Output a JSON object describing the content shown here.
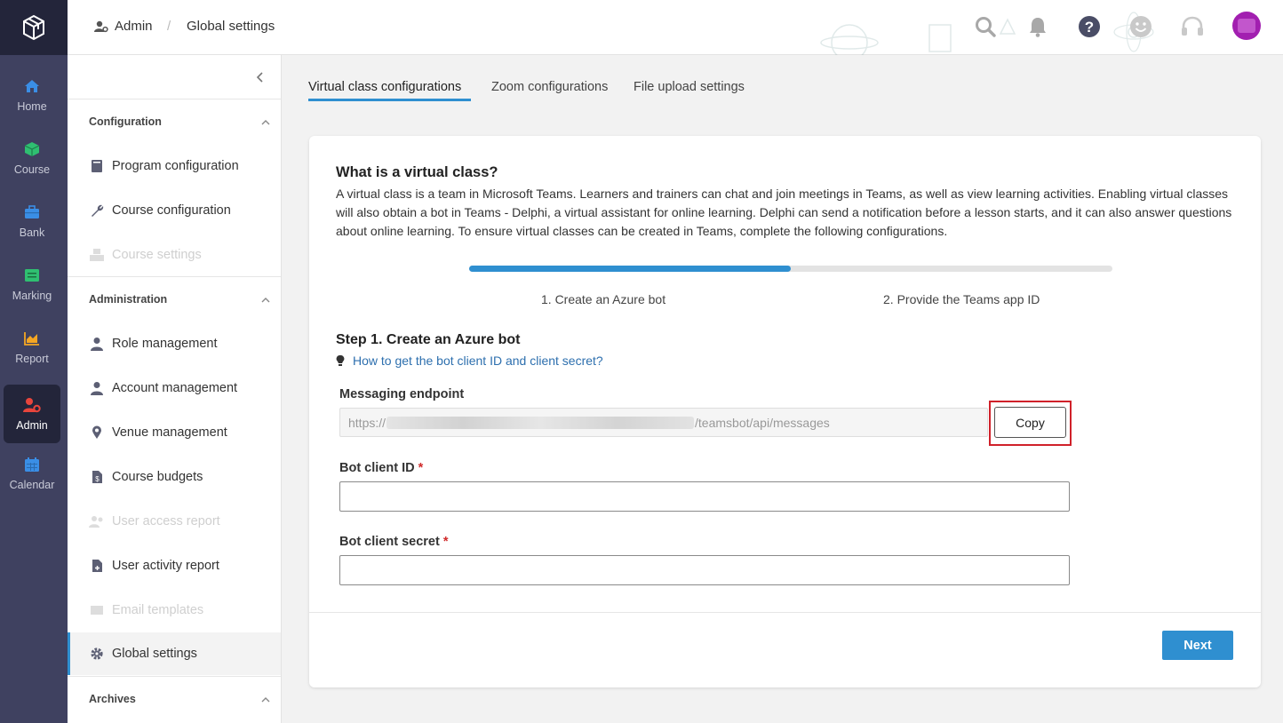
{
  "rail": {
    "items": [
      {
        "label": "Home",
        "icon": "home-icon",
        "color": "#3a8ee6"
      },
      {
        "label": "Course",
        "icon": "cube-icon",
        "color": "#2fbf71"
      },
      {
        "label": "Bank",
        "icon": "briefcase-icon",
        "color": "#3a8ee6"
      },
      {
        "label": "Marking",
        "icon": "marking-icon",
        "color": "#2fbf71"
      },
      {
        "label": "Report",
        "icon": "chart-area-icon",
        "color": "#f5a623"
      },
      {
        "label": "Admin",
        "icon": "user-gear-icon",
        "color": "#e8453c"
      },
      {
        "label": "Calendar",
        "icon": "calendar-icon",
        "color": "#3a8ee6"
      }
    ],
    "active": "Admin"
  },
  "header": {
    "breadcrumb": [
      "Admin",
      "Global settings"
    ],
    "icons": [
      "search-icon",
      "bell-icon",
      "help-icon",
      "smiley-icon",
      "headset-icon",
      "avatar"
    ]
  },
  "sidebar": {
    "sections": [
      {
        "title": "Configuration",
        "items": [
          {
            "label": "Program configuration",
            "icon": "book-icon",
            "disabled": false
          },
          {
            "label": "Course configuration",
            "icon": "wrench-icon",
            "disabled": false
          },
          {
            "label": "Course settings",
            "icon": "cubes-icon",
            "disabled": true
          }
        ]
      },
      {
        "title": "Administration",
        "items": [
          {
            "label": "Role management",
            "icon": "user-tie-icon",
            "disabled": false
          },
          {
            "label": "Account management",
            "icon": "user-icon",
            "disabled": false
          },
          {
            "label": "Venue management",
            "icon": "map-pin-icon",
            "disabled": false
          },
          {
            "label": "Course budgets",
            "icon": "file-dollar-icon",
            "disabled": false
          },
          {
            "label": "User access report",
            "icon": "users-icon",
            "disabled": true
          },
          {
            "label": "User activity report",
            "icon": "file-plus-icon",
            "disabled": false
          },
          {
            "label": "Email templates",
            "icon": "email-icon",
            "disabled": true
          },
          {
            "label": "Global settings",
            "icon": "gear-icon",
            "disabled": false,
            "selected": true
          }
        ]
      },
      {
        "title": "Archives",
        "items": []
      }
    ]
  },
  "tabs": [
    {
      "label": "Virtual class configurations",
      "active": true
    },
    {
      "label": "Zoom configurations",
      "active": false
    },
    {
      "label": "File upload settings",
      "active": false
    }
  ],
  "card": {
    "title": "What is a virtual class?",
    "description": "A virtual class is a team in Microsoft Teams. Learners and trainers can chat and join meetings in Teams, as well as view learning activities. Enabling virtual classes will also obtain a bot in Teams - Delphi, a virtual assistant for online learning. Delphi can send a notification before a lesson starts, and it can also answer questions about online learning. To ensure virtual classes can be created in Teams, complete the following configurations.",
    "progress": 0.5,
    "steps": [
      "1. Create an Azure bot",
      "2. Provide the Teams app ID"
    ],
    "step_title": "Step 1. Create an Azure bot",
    "help_link": "How to get the bot client ID and client secret?",
    "endpoint": {
      "label": "Messaging endpoint",
      "value_prefix": "https://",
      "value_suffix": "/teamsbot/api/messages",
      "copy_label": "Copy"
    },
    "client_id": {
      "label": "Bot client ID",
      "required_mark": "*",
      "value": ""
    },
    "client_secret": {
      "label": "Bot client secret",
      "required_mark": "*",
      "value": ""
    },
    "next_label": "Next"
  },
  "colors": {
    "accent": "#2f8fd0",
    "rail": "#3f4160",
    "rail_active": "#23253a",
    "highlight": "#d0212a"
  }
}
